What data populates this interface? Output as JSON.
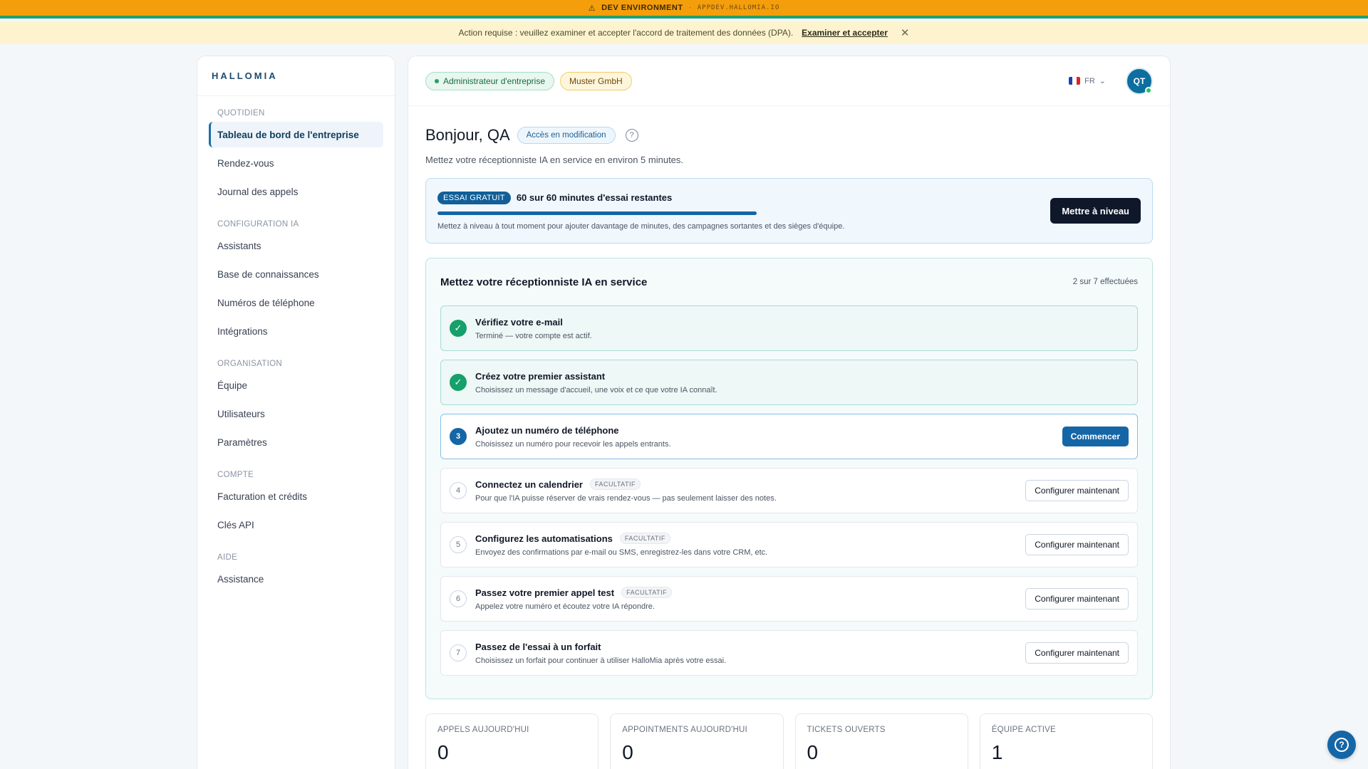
{
  "dev_banner": {
    "icon": "warning-icon",
    "label": "DEV ENVIRONMENT",
    "separator": "·",
    "host": "APPDEV.HALLOMIA.IO"
  },
  "notice": {
    "text": "Action requise : veuillez examiner et accepter l'accord de traitement des données (DPA).",
    "link": "Examiner et accepter",
    "close_icon": "close-icon"
  },
  "brand": "HALLOMIA",
  "sidebar": {
    "sections": [
      {
        "heading": "QUOTIDIEN",
        "items": [
          "Tableau de bord de l'entreprise",
          "Rendez-vous",
          "Journal des appels"
        ]
      },
      {
        "heading": "CONFIGURATION IA",
        "items": [
          "Assistants",
          "Base de connaissances",
          "Numéros de téléphone",
          "Intégrations"
        ]
      },
      {
        "heading": "ORGANISATION",
        "items": [
          "Équipe",
          "Utilisateurs",
          "Paramètres"
        ]
      },
      {
        "heading": "COMPTE",
        "items": [
          "Facturation et crédits",
          "Clés API"
        ]
      },
      {
        "heading": "AIDE",
        "items": [
          "Assistance"
        ]
      }
    ],
    "active": "Tableau de bord de l'entreprise"
  },
  "topbar": {
    "role_chip": "Administrateur d'entreprise",
    "org_chip": "Muster GmbH",
    "language": "FR",
    "avatar": "QT"
  },
  "header": {
    "greeting": "Bonjour, QA",
    "access_chip": "Accès en modification",
    "help_icon": "?",
    "subtitle": "Mettez votre réceptionniste IA en service en environ 5 minutes."
  },
  "trial": {
    "badge": "ESSAI GRATUIT",
    "text": "60 sur 60 minutes d'essai restantes",
    "progress": 1.0,
    "note": "Mettez à niveau à tout moment pour ajouter davantage de minutes, des campagnes sortantes et des sièges d'équipe.",
    "button": "Mettre à niveau"
  },
  "onboarding": {
    "title": "Mettez votre réceptionniste IA en service",
    "count": "2 sur 7 effectuées",
    "steps": [
      {
        "num": "✓",
        "title": "Vérifiez votre e-mail",
        "desc": "Terminé — votre compte est actif.",
        "optional": "",
        "button": ""
      },
      {
        "num": "✓",
        "title": "Créez votre premier assistant",
        "desc": "Choisissez un message d'accueil, une voix et ce que votre IA connaît.",
        "optional": "",
        "button": ""
      },
      {
        "num": "3",
        "title": "Ajoutez un numéro de téléphone",
        "desc": "Choisissez un numéro pour recevoir les appels entrants.",
        "optional": "",
        "button": "Commencer"
      },
      {
        "num": "4",
        "title": "Connectez un calendrier",
        "desc": "Pour que l'IA puisse réserver de vrais rendez-vous — pas seulement laisser des notes.",
        "optional": "FACULTATIF",
        "button": "Configurer maintenant"
      },
      {
        "num": "5",
        "title": "Configurez les automatisations",
        "desc": "Envoyez des confirmations par e-mail ou SMS, enregistrez-les dans votre CRM, etc.",
        "optional": "FACULTATIF",
        "button": "Configurer maintenant"
      },
      {
        "num": "6",
        "title": "Passez votre premier appel test",
        "desc": "Appelez votre numéro et écoutez votre IA répondre.",
        "optional": "FACULTATIF",
        "button": "Configurer maintenant"
      },
      {
        "num": "7",
        "title": "Passez de l'essai à un forfait",
        "desc": "Choisissez un forfait pour continuer à utiliser HalloMia après votre essai.",
        "optional": "",
        "button": "Configurer maintenant"
      }
    ]
  },
  "stats": [
    {
      "label": "APPELS AUJOURD'HUI",
      "value": "0"
    },
    {
      "label": "APPOINTMENTS AUJOURD'HUI",
      "value": "0"
    },
    {
      "label": "TICKETS OUVERTS",
      "value": "0"
    },
    {
      "label": "ÉQUIPE ACTIVE",
      "value": "1"
    }
  ],
  "colors": {
    "accent": "#1566a6",
    "dev_banner": "#f59e0b",
    "success": "#16a06b"
  }
}
